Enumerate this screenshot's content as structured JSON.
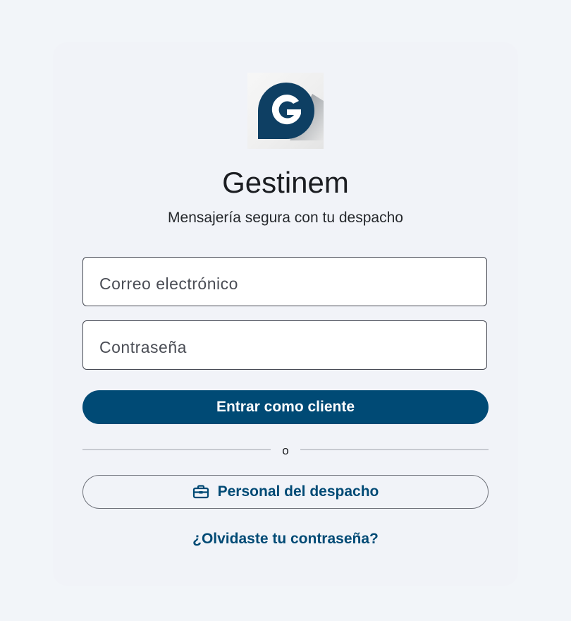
{
  "app": {
    "title": "Gestinem",
    "subtitle": "Mensajería segura con tu despacho"
  },
  "logo": {
    "letter": "G",
    "icon": "gestinem-logo-icon"
  },
  "form": {
    "email_placeholder": "Correo electrónico",
    "password_placeholder": "Contraseña",
    "submit_label": "Entrar como cliente"
  },
  "divider": {
    "text": "o"
  },
  "staff": {
    "label": "Personal del despacho",
    "icon": "briefcase-icon"
  },
  "forgot": {
    "label": "¿Olvidaste tu contraseña?"
  },
  "colors": {
    "primary": "#004a75",
    "background": "#f2f5f9",
    "card": "#f1f3f8"
  }
}
